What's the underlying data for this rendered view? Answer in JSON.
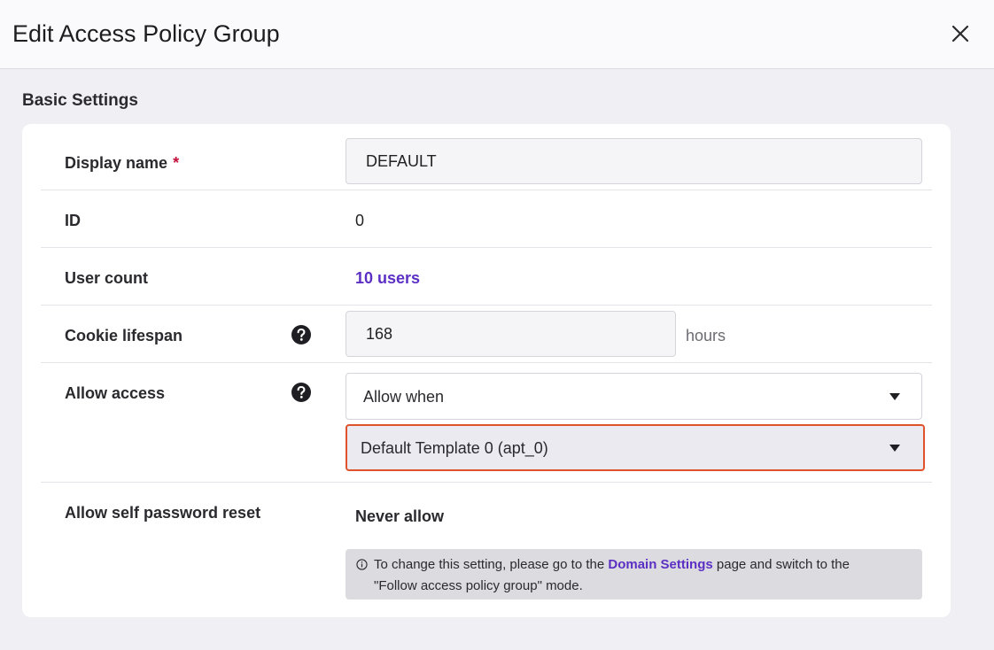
{
  "dialog": {
    "title": "Edit Access Policy Group",
    "close_icon": "close-icon"
  },
  "section": {
    "title": "Basic Settings"
  },
  "fields": {
    "display_name": {
      "label": "Display name",
      "required_mark": "*",
      "value": "DEFAULT"
    },
    "id": {
      "label": "ID",
      "value": "0"
    },
    "user_count": {
      "label": "User count",
      "value": "10 users"
    },
    "cookie_lifespan": {
      "label": "Cookie lifespan",
      "help_icon": "question-circle-icon",
      "value": "168",
      "unit": "hours"
    },
    "allow_access": {
      "label": "Allow access",
      "help_icon": "question-circle-icon",
      "mode_selected": "Allow when",
      "template_selected": "Default Template 0 (apt_0)",
      "highlight_color": "#e0522b"
    },
    "allow_self_password_reset": {
      "label": "Allow self password reset",
      "value": "Never allow",
      "notice": {
        "icon": "info-circle-icon",
        "text_before": "To change this setting, please go to the ",
        "link_text": "Domain Settings",
        "text_middle": " page and switch to the",
        "text_after": "\"Follow access policy group\" mode."
      }
    }
  },
  "colors": {
    "link": "#5b2fc4",
    "required": "#c4113b",
    "highlight_border": "#e0522b"
  }
}
